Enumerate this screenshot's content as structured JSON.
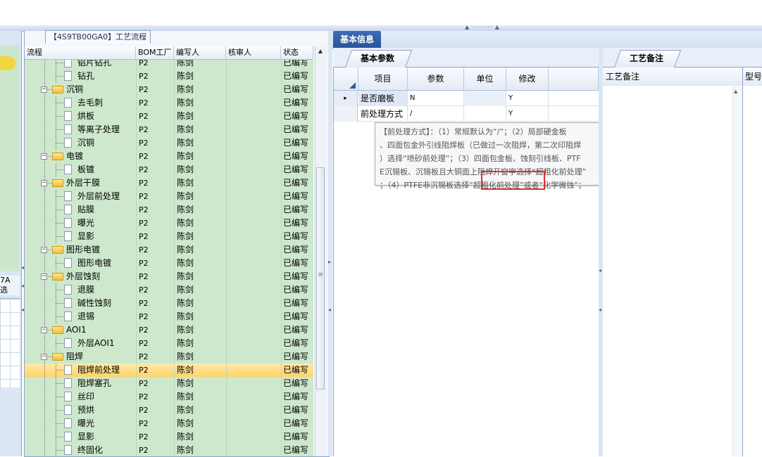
{
  "left_strip": {
    "label_line1": "7A",
    "label_line2": "选"
  },
  "tree": {
    "title": "【4S9TB00GA0】工艺流程",
    "columns": {
      "flow": "流程",
      "bom": "BOM工厂",
      "author": "编写人",
      "reviewer": "核审人",
      "status": "状态"
    },
    "rows": [
      {
        "level": 1,
        "type": "page",
        "name": "铝片钻孔",
        "bom": "P2",
        "author": "陈剑",
        "status": "已编写"
      },
      {
        "level": 1,
        "type": "page",
        "name": "钻孔",
        "bom": "P2",
        "author": "陈剑",
        "status": "已编写"
      },
      {
        "level": 0,
        "type": "folder",
        "name": "沉铜",
        "bom": "P2",
        "author": "陈剑",
        "status": "已编写"
      },
      {
        "level": 1,
        "type": "page",
        "name": "去毛刺",
        "bom": "P2",
        "author": "陈剑",
        "status": "已编写"
      },
      {
        "level": 1,
        "type": "page",
        "name": "烘板",
        "bom": "P2",
        "author": "陈剑",
        "status": "已编写"
      },
      {
        "level": 1,
        "type": "page",
        "name": "等离子处理",
        "bom": "P2",
        "author": "陈剑",
        "status": "已编写"
      },
      {
        "level": 1,
        "type": "page",
        "name": "沉铜",
        "bom": "P2",
        "author": "陈剑",
        "status": "已编写"
      },
      {
        "level": 0,
        "type": "folder",
        "name": "电镀",
        "bom": "P2",
        "author": "陈剑",
        "status": "已编写"
      },
      {
        "level": 1,
        "type": "page",
        "name": "板镀",
        "bom": "P2",
        "author": "陈剑",
        "status": "已编写"
      },
      {
        "level": 0,
        "type": "folder",
        "name": "外层干膜",
        "bom": "P2",
        "author": "陈剑",
        "status": "已编写"
      },
      {
        "level": 1,
        "type": "page",
        "name": "外层前处理",
        "bom": "P2",
        "author": "陈剑",
        "status": "已编写"
      },
      {
        "level": 1,
        "type": "page",
        "name": "贴膜",
        "bom": "P2",
        "author": "陈剑",
        "status": "已编写"
      },
      {
        "level": 1,
        "type": "page",
        "name": "曝光",
        "bom": "P2",
        "author": "陈剑",
        "status": "已编写"
      },
      {
        "level": 1,
        "type": "page",
        "name": "显影",
        "bom": "P2",
        "author": "陈剑",
        "status": "已编写"
      },
      {
        "level": 0,
        "type": "folder",
        "name": "图形电镀",
        "bom": "P2",
        "author": "陈剑",
        "status": "已编写"
      },
      {
        "level": 1,
        "type": "page",
        "name": "图形电镀",
        "bom": "P2",
        "author": "陈剑",
        "status": "已编写"
      },
      {
        "level": 0,
        "type": "folder",
        "name": "外层蚀刻",
        "bom": "P2",
        "author": "陈剑",
        "status": "已编写"
      },
      {
        "level": 1,
        "type": "page",
        "name": "退膜",
        "bom": "P2",
        "author": "陈剑",
        "status": "已编写"
      },
      {
        "level": 1,
        "type": "page",
        "name": "碱性蚀刻",
        "bom": "P2",
        "author": "陈剑",
        "status": "已编写"
      },
      {
        "level": 1,
        "type": "page",
        "name": "退锡",
        "bom": "P2",
        "author": "陈剑",
        "status": "已编写"
      },
      {
        "level": 0,
        "type": "folder",
        "name": "AOI1",
        "bom": "P2",
        "author": "陈剑",
        "status": "已编写"
      },
      {
        "level": 1,
        "type": "page",
        "name": "外层AOI1",
        "bom": "P2",
        "author": "陈剑",
        "status": "已编写"
      },
      {
        "level": 0,
        "type": "folder",
        "name": "阻焊",
        "bom": "P2",
        "author": "陈剑",
        "status": "已编写"
      },
      {
        "level": 1,
        "type": "page",
        "name": "阻焊前处理",
        "bom": "P2",
        "author": "陈剑",
        "status": "已编写",
        "selected": true
      },
      {
        "level": 1,
        "type": "page",
        "name": "阻焊塞孔",
        "bom": "P2",
        "author": "陈剑",
        "status": "已编写"
      },
      {
        "level": 1,
        "type": "page",
        "name": "丝印",
        "bom": "P2",
        "author": "陈剑",
        "status": "已编写"
      },
      {
        "level": 1,
        "type": "page",
        "name": "预烘",
        "bom": "P2",
        "author": "陈剑",
        "status": "已编写"
      },
      {
        "level": 1,
        "type": "page",
        "name": "曝光",
        "bom": "P2",
        "author": "陈剑",
        "status": "已编写"
      },
      {
        "level": 1,
        "type": "page",
        "name": "显影",
        "bom": "P2",
        "author": "陈剑",
        "status": "已编写"
      },
      {
        "level": 1,
        "type": "page",
        "name": "终固化",
        "bom": "P2",
        "author": "陈剑",
        "status": "已编写"
      }
    ]
  },
  "main_tab": {
    "label": "基本信息"
  },
  "params": {
    "tab_label": "基本参数",
    "columns": {
      "item": "项目",
      "param": "参数",
      "unit": "单位",
      "modify": "修改"
    },
    "rows": [
      {
        "item": "是否磨板",
        "param": "N",
        "unit": "",
        "modify": "Y",
        "current": true
      },
      {
        "item": "前处理方式",
        "param": "/",
        "unit": "",
        "modify": "Y",
        "current": false
      }
    ]
  },
  "tooltip": {
    "lines": [
      "【前处理方式】：（1）常规默认为“/”；（2）局部硬金板",
      "、四面包金外引线阻焊板（已做过一次阻焊，第二次印阻焊",
      "）选择“喷砂前处理”；（3）四面包金板、蚀刻引线板、PTF",
      "E沉锡板、沉锡板且大铜面上阻焊开窗字选择“超粗化前处理”",
      "；（4）PTFE非沉锡板选择“超粗化前处理”或者“化学微蚀”；"
    ]
  },
  "notes": {
    "tab_label": "工艺备注",
    "col1": "工艺备注",
    "col2": "型号"
  },
  "icons": {
    "row_indicator": "row-pointer-icon",
    "sort": "sort-corner-icon"
  },
  "colors": {
    "tree_bg": "#cde8cc",
    "selected_row": "#ffd36b",
    "tab_active": "#2a5596",
    "highlight": "#e23030"
  }
}
